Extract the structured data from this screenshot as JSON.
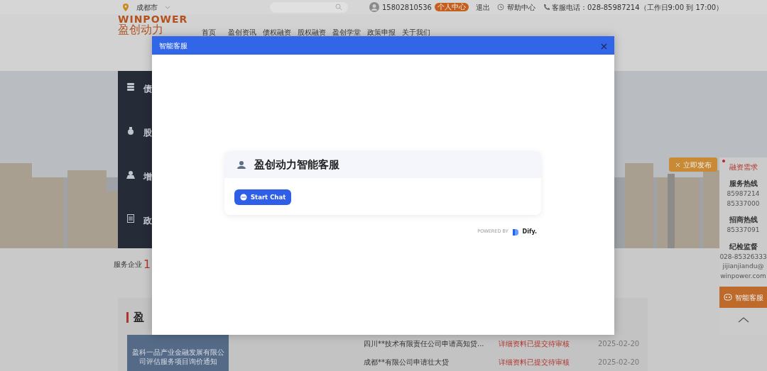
{
  "top_bar": {
    "city": "成都市",
    "phone": "15802810536",
    "badge": "个人中心",
    "logout": "退出",
    "help": "帮助中心",
    "hotline": "客服电话：028-85987214（工作日9:00 到 17:00）"
  },
  "header": {
    "logo_en": "WINPOWER",
    "logo_cn": "盈创动力",
    "nav": [
      "首页",
      "盈创资讯",
      "债权融资",
      "股权融资",
      "盈创学堂",
      "政策申报",
      "关于我们"
    ]
  },
  "hero": {
    "side_menu": [
      {
        "kind": "stack",
        "label": "债"
      },
      {
        "kind": "bag",
        "label": "股"
      },
      {
        "kind": "person",
        "label": "增"
      },
      {
        "kind": "doc",
        "label": "政"
      }
    ]
  },
  "stats": {
    "label": "服务企业",
    "value": "1"
  },
  "float_panel": {
    "publish": "立即发布",
    "demand": "融资需求",
    "groups": [
      {
        "title": "服务热线",
        "lines": [
          "85987214",
          "85337000"
        ]
      },
      {
        "title": "招商热线",
        "lines": [
          "85337091"
        ]
      },
      {
        "title": "纪检监督",
        "lines": [
          "028-85326333",
          "jijianjiandu@",
          "winpower.com"
        ]
      }
    ],
    "service": "智能客服"
  },
  "news": {
    "title": "盈",
    "notice": "盈科一品产业金融发展有限公司评估服务项目询价通知",
    "rows": [
      {
        "title": "四川**技术有限责任公司申请高知贷...",
        "status": "详细资料已提交待审核",
        "date": "2025-02-20"
      },
      {
        "title": "成都**有限公司申请壮大贷",
        "status": "详细资料已提交待审核",
        "date": "2025-02-20"
      }
    ]
  },
  "modal": {
    "title": "智能客服",
    "card_title": "盈创动力智能客服",
    "button": "Start Chat",
    "powered_by": "POWERED BY",
    "brand": "Dify."
  }
}
